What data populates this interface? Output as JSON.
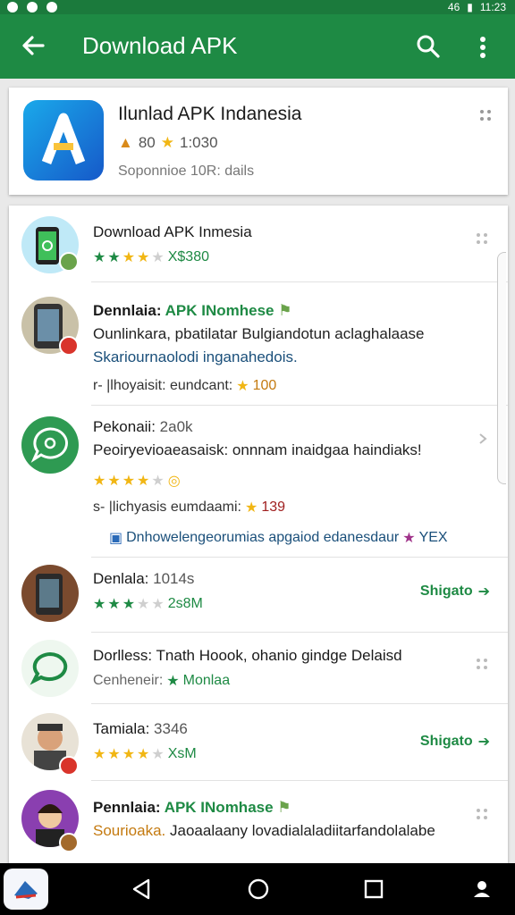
{
  "status_bar": {
    "time": "11:23",
    "signal_text": "46"
  },
  "app_bar": {
    "title": "Download APK"
  },
  "hero": {
    "title": "Ilunlad APK Indanesia",
    "rating_text": "80",
    "rating_value": "1:030",
    "subtitle": "Soponnioe 10R: dails"
  },
  "list": [
    {
      "title": "Download APK Inmesia",
      "stars_filled": 4,
      "stars_total": 5,
      "meta": "X$380"
    },
    {
      "title_prefix": "Dennlaia:",
      "title_highlight": "APK INomhese",
      "line2": "Ounlinkara, pbatilatar Bulgiandotun aclaghalaase",
      "line3": "Skariournaolodi inganahedois.",
      "line4_text": "r- |lhoyaisit: eundcant:",
      "line4_value": "100"
    },
    {
      "title_prefix": "Pekonaii:",
      "title_value": "2a0k",
      "line2": "Peoiryevioaeasaisk: onnnam inaidgaa haindiaks!",
      "stars_filled": 4,
      "stars_total": 5,
      "line4_text": "s- |lichyasis eumdaami:",
      "line4_value": "139",
      "footer_text": "Dnhowelengeorumias apgaiod edanesdaur",
      "footer_tail": "YEX"
    },
    {
      "title_prefix": "Denlala:",
      "title_value": "1014s",
      "stars_filled": 3,
      "stars_total": 5,
      "meta": "2s8M",
      "action": "Shigato"
    },
    {
      "title": "Dorlless: Tnath Hoook, ohanio gindge Delaisd",
      "sub_prefix": "Cenheneir:",
      "sub_value": "Monlaa"
    },
    {
      "title_prefix": "Tamiala:",
      "title_value": "3346",
      "stars_filled": 4,
      "stars_total": 5,
      "meta": "XsM",
      "action": "Shigato"
    },
    {
      "title_prefix": "Pennlaia:",
      "title_highlight": "APK INomhase",
      "sub_prefix": "Sourioaka.",
      "line2": "Jaoaalaany lovadialaladiitarfandolalabe"
    }
  ],
  "colors": {
    "primary": "#1e8a44",
    "primary_dark": "#1b7a3c",
    "star_yellow": "#f1b614"
  }
}
